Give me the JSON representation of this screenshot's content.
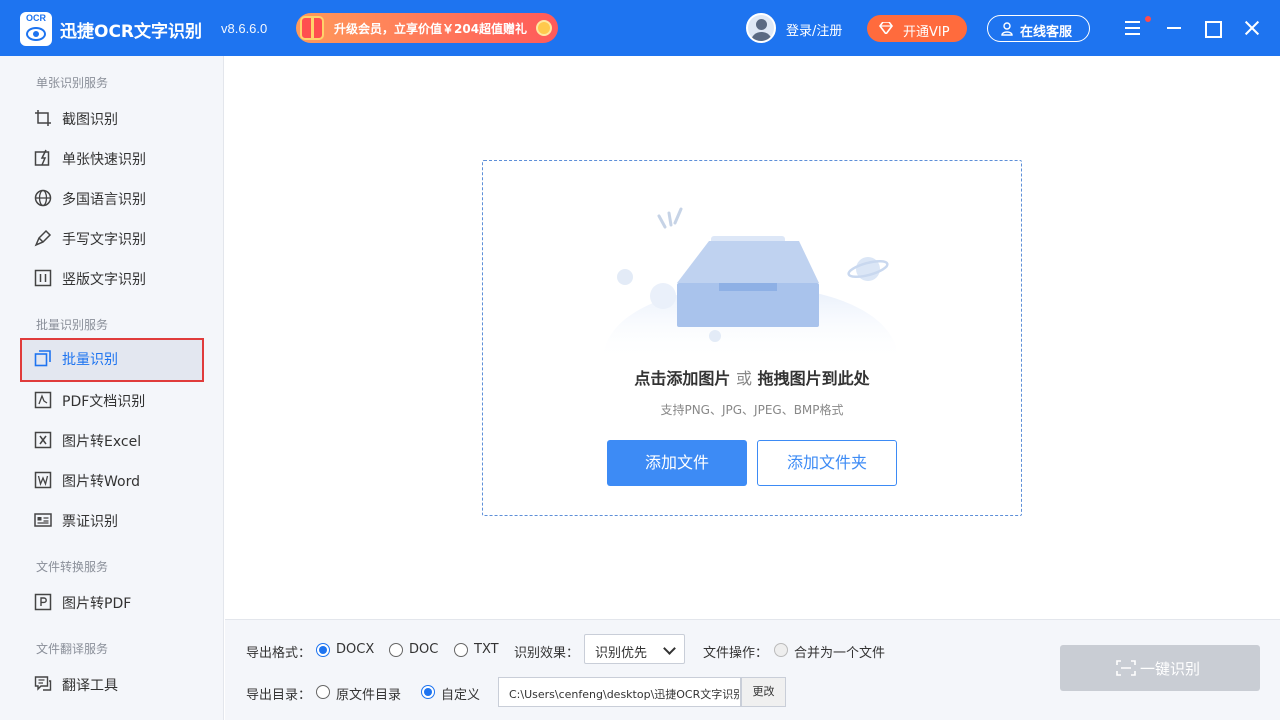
{
  "app": {
    "logo_text": "OCR",
    "name": "迅捷OCR文字识别",
    "version": "v8.6.6.0"
  },
  "header": {
    "promo_text": "升级会员，立享价值￥204超值赠礼",
    "login_label": "登录/注册",
    "vip_label": "开通VIP",
    "service_label": "在线客服"
  },
  "sidebar": {
    "sections": [
      {
        "title": "单张识别服务"
      },
      {
        "title": "批量识别服务"
      },
      {
        "title": "文件转换服务"
      },
      {
        "title": "文件翻译服务"
      }
    ],
    "items": [
      {
        "label": "截图识别",
        "icon": "crop-icon"
      },
      {
        "label": "单张快速识别",
        "icon": "quick-scan-icon"
      },
      {
        "label": "多国语言识别",
        "icon": "globe-icon"
      },
      {
        "label": "手写文字识别",
        "icon": "pen-icon"
      },
      {
        "label": "竖版文字识别",
        "icon": "vertical-text-icon"
      },
      {
        "label": "批量识别",
        "icon": "batch-icon",
        "active": true
      },
      {
        "label": "PDF文档识别",
        "icon": "pdf-icon"
      },
      {
        "label": "图片转Excel",
        "icon": "excel-icon"
      },
      {
        "label": "图片转Word",
        "icon": "word-icon"
      },
      {
        "label": "票证识别",
        "icon": "ticket-icon"
      },
      {
        "label": "图片转PDF",
        "icon": "pdf-convert-icon"
      },
      {
        "label": "翻译工具",
        "icon": "translate-icon"
      }
    ]
  },
  "dropzone": {
    "title_part1": "点击添加图片",
    "title_or": "或",
    "title_part2": "拖拽图片到此处",
    "hint": "支持PNG、JPG、JPEG、BMP格式",
    "add_file_label": "添加文件",
    "add_folder_label": "添加文件夹"
  },
  "bottom": {
    "export_format_label": "导出格式：",
    "format_options": [
      "DOCX",
      "DOC",
      "TXT"
    ],
    "format_selected": "DOCX",
    "recog_effect_label": "识别效果：",
    "recog_effect_value": "识别优先",
    "file_op_label": "文件操作：",
    "merge_label": "合并为一个文件",
    "export_dir_label": "导出目录：",
    "dir_options": [
      "原文件目录",
      "自定义"
    ],
    "dir_selected": "自定义",
    "path_value": "C:\\Users\\cenfeng\\desktop\\迅捷OCR文字识别",
    "change_label": "更改",
    "oneclick_label": "一键识别"
  },
  "colors": {
    "brand": "#1e74f0",
    "vip": "#ff6b3d",
    "active_border": "#e03b3b",
    "disabled_button": "#c9cdd4"
  }
}
